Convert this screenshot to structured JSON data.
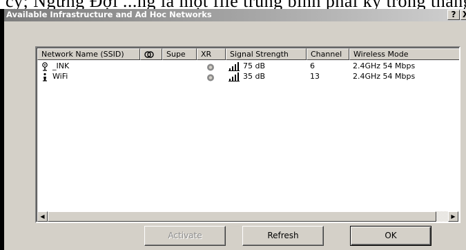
{
  "page_top_text": "cy; Ngưng Đợi ...ng là một file trung bình phải ký trong tháng cụ tủy",
  "window": {
    "title": "Available Infrastructure and Ad Hoc Networks",
    "help_label": "?",
    "close_label": "X"
  },
  "list": {
    "columns": [
      "Network Name (SSID)",
      "",
      "Supe",
      "XR",
      "Signal Strength",
      "Channel",
      "Wireless Mode"
    ],
    "rows": [
      {
        "ssid": "_INK",
        "network_icon": "antenna-icon",
        "xr_icon": "xr-lock-icon",
        "signal_icon": "signal-bars-icon",
        "signal": "75 dB",
        "channel": "6",
        "mode": "2.4GHz 54 Mbps"
      },
      {
        "ssid": "WiFi",
        "network_icon": "access-point-icon",
        "xr_icon": "xr-lock-icon",
        "signal_icon": "signal-bars-icon",
        "signal": "35 dB",
        "channel": "13",
        "mode": "2.4GHz 54 Mbps"
      }
    ]
  },
  "scrollbar": {
    "left_arrow": "◀",
    "right_arrow": "▶"
  },
  "buttons": {
    "activate": "Activate",
    "refresh": "Refresh",
    "ok": "OK"
  },
  "colors": {
    "dialog_bg": "#d4d0c8",
    "titlebar_start": "#7d7d7d",
    "titlebar_end": "#d0d0d0",
    "disabled_text": "#8c8c8c"
  }
}
